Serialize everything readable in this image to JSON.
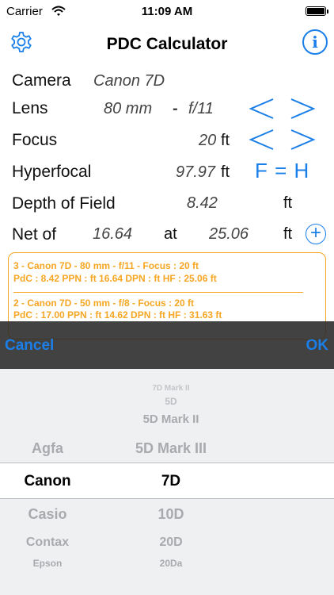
{
  "status_bar": {
    "carrier": "Carrier",
    "time": "11:09 AM"
  },
  "nav": {
    "title": "PDC Calculator",
    "info_icon": "i"
  },
  "rows": {
    "camera": {
      "label": "Camera",
      "value": "Canon 7D"
    },
    "lens": {
      "label": "Lens",
      "focal": "80 mm",
      "dash": "-",
      "aperture": "f/11"
    },
    "focus": {
      "label": "Focus",
      "value": "20",
      "unit": "ft"
    },
    "hyperfocal": {
      "label": "Hyperfocal",
      "value": "97.97",
      "unit": "ft",
      "button": "F = H"
    },
    "dof": {
      "label": "Depth of Field",
      "value": "8.42",
      "unit": "ft"
    },
    "net": {
      "label": "Net of",
      "near": "16.64",
      "at": "at",
      "far": "25.06",
      "unit": "ft"
    }
  },
  "history": [
    {
      "line1": "3 - Canon 7D -   80 mm - f/11 - Focus : 20 ft",
      "line2": "PdC : 8.42 PPN : ft 16.64 DPN : ft HF : 25.06 ft"
    },
    {
      "line1": "2 - Canon 7D -   50 mm - f/8 - Focus : 20 ft",
      "line2": "PdC : 17.00 PPN : ft 14.62 DPN : ft HF : 31.63 ft"
    }
  ],
  "toolbar": {
    "cancel": "Cancel",
    "ok": "OK"
  },
  "picker": {
    "brands": [
      "Agfa",
      "Canon",
      "Casio",
      "Contax",
      "Epson"
    ],
    "models_above": [
      "7D Mark II",
      "5D",
      "5D Mark II",
      "5D Mark III"
    ],
    "selected_brand": "Canon",
    "selected_model": "7D",
    "models_below": [
      "10D",
      "20D",
      "20Da"
    ]
  },
  "colors": {
    "accent": "#1a7fe8",
    "history": "#f5a623"
  },
  "icons": [
    "wifi-icon",
    "battery-icon",
    "gear-icon",
    "info-icon",
    "chevron-left-icon",
    "chevron-right-icon",
    "plus-circle-icon"
  ]
}
